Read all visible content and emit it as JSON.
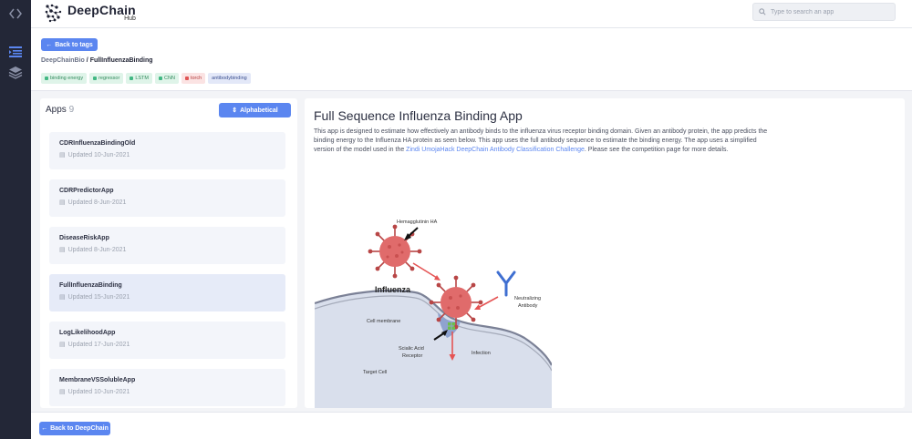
{
  "sidebar": {
    "icons": [
      "code-brackets-icon",
      "outline-list-icon",
      "layers-icon"
    ]
  },
  "header": {
    "logo_name": "DeepChain",
    "logo_sub": "Hub",
    "search_placeholder": "Type to search an app"
  },
  "top": {
    "back_to_tags": "Back to tags",
    "breadcrumb_org": "DeepChainBio",
    "breadcrumb_sep": " / ",
    "breadcrumb_app": "FullInfluenzaBinding",
    "tags": [
      {
        "label": "binding energy",
        "kind": "green"
      },
      {
        "label": "regressor",
        "kind": "green"
      },
      {
        "label": "LSTM",
        "kind": "green"
      },
      {
        "label": "CNN",
        "kind": "green"
      },
      {
        "label": "torch",
        "kind": "red"
      },
      {
        "label": "antibodybinding",
        "kind": "blue"
      }
    ]
  },
  "apps": {
    "title": "Apps",
    "count": "9",
    "sort_label": "Alphabetical",
    "items": [
      {
        "name": "CDRInfluenzaBindingOld",
        "date": "Updated 10-Jun-2021",
        "active": false
      },
      {
        "name": "CDRPredictorApp",
        "date": "Updated 8-Jun-2021",
        "active": false
      },
      {
        "name": "DiseaseRiskApp",
        "date": "Updated 8-Jun-2021",
        "active": false
      },
      {
        "name": "FullInfluenzaBinding",
        "date": "Updated 15-Jun-2021",
        "active": true
      },
      {
        "name": "LogLikelihoodApp",
        "date": "Updated 17-Jun-2021",
        "active": false
      },
      {
        "name": "MembraneVSSolubleApp",
        "date": "Updated 10-Jun-2021",
        "active": false
      }
    ]
  },
  "detail": {
    "title": "Full Sequence Influenza Binding App",
    "desc_part1": "This app is designed to estimate how effectively an antibody binds to the influenza virus receptor binding domain. Given an antibody protein, the app predicts the binding energy to the Influenza HA protein as seen below. This app uses the full antibody sequence to estimate the binding energy. The app uses a simplified version of the model used in the ",
    "desc_link": "Zindi UmojaHack DeepChain Antibody Classification Challenge",
    "desc_part2": ". Please see the competition page for more details.",
    "diagram": {
      "hemagglutinin": "Hemagglutinin HA",
      "influenza": "Influenza",
      "neutralizing": "Neutralizing",
      "antibody": "Antibody",
      "cell_membrane": "Cell membrane",
      "scialic": "Scialic Acid",
      "receptor": "Receptor",
      "infection": "Infection",
      "target_cell": "Target Cell"
    }
  },
  "footer": {
    "back_label": "Back to DeepChain"
  },
  "colors": {
    "accent": "#5b86f0",
    "sidebar": "#232737",
    "virus": "#e06b6b"
  }
}
